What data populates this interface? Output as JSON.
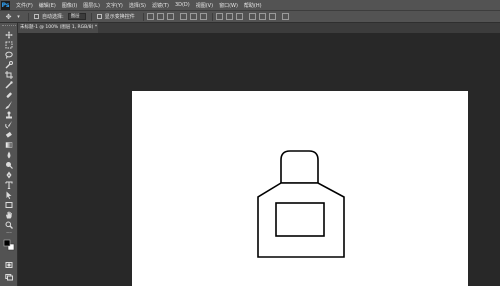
{
  "app": {
    "logo_text": "Ps"
  },
  "menu": {
    "items": [
      {
        "label": "文件(F)"
      },
      {
        "label": "编辑(E)"
      },
      {
        "label": "图像(I)"
      },
      {
        "label": "图层(L)"
      },
      {
        "label": "文字(Y)"
      },
      {
        "label": "选择(S)"
      },
      {
        "label": "滤镜(T)"
      },
      {
        "label": "3D(D)"
      },
      {
        "label": "视图(V)"
      },
      {
        "label": "窗口(W)"
      },
      {
        "label": "帮助(H)"
      }
    ]
  },
  "options_bar": {
    "auto_select_label": "自动选择:",
    "auto_select_value": "图层",
    "show_transform_label": "显示变换控件"
  },
  "document_tab": {
    "title": "未标题-1 @ 100% (图层 1, RGB/8) *"
  },
  "colors": {
    "chrome": "#535353",
    "workspace": "#282828",
    "canvas": "#ffffff",
    "ps_blue": "#31a8ff"
  }
}
